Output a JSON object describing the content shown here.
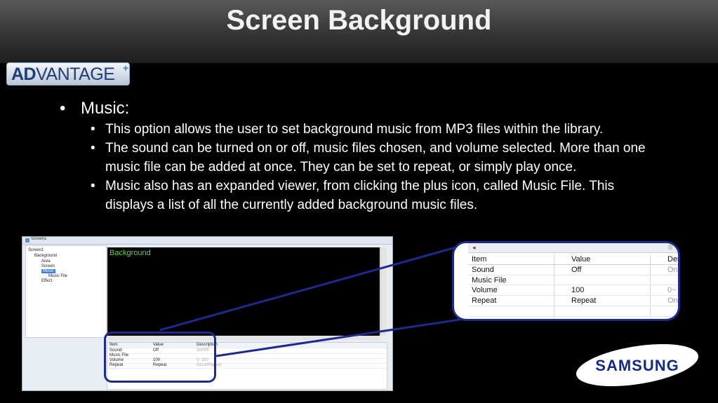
{
  "slide": {
    "title": "Screen Background"
  },
  "logo": {
    "text_bold": "AD",
    "text_rest": "VANTAGE",
    "superscript": "+"
  },
  "bullets": {
    "main": "Music:",
    "sub": [
      "This option allows the user to set background music from MP3 files within the library.",
      "The sound can be turned on or off, music files chosen, and volume selected. More than one music file can be added at once. They can be set to repeat, or simply play once.",
      "Music also has an expanded viewer, from clicking the plus icon, called Music File. This displays a list of all the currently added background music files."
    ]
  },
  "app_window": {
    "tab": "Screen1",
    "tree": [
      "Screen1",
      "Background",
      "Area",
      "Screen",
      "Music",
      "Music File",
      "Effect"
    ],
    "canvas_label": "Background",
    "table_headers": [
      "Item",
      "Value",
      "Description"
    ],
    "table_rows": [
      [
        "Sound",
        "Off",
        "On/Off"
      ],
      [
        "Music File",
        "",
        ""
      ],
      [
        "Volume",
        "100",
        "0~100"
      ],
      [
        "Repeat",
        "Repeat",
        "Once/Repeat"
      ]
    ]
  },
  "zoom_panel": {
    "headers": [
      "Item",
      "Value",
      "Des"
    ],
    "rows": [
      [
        "Sound",
        "Off",
        "On"
      ],
      [
        "Music File",
        "",
        ""
      ],
      [
        "Volume",
        "100",
        "0~"
      ],
      [
        "Repeat",
        "Repeat",
        "On"
      ]
    ]
  },
  "brand": {
    "name": "SAMSUNG"
  },
  "colors": {
    "callout_border": "#1e2a8c",
    "canvas_label": "#66d43f",
    "samsung_blue": "#152a82"
  }
}
